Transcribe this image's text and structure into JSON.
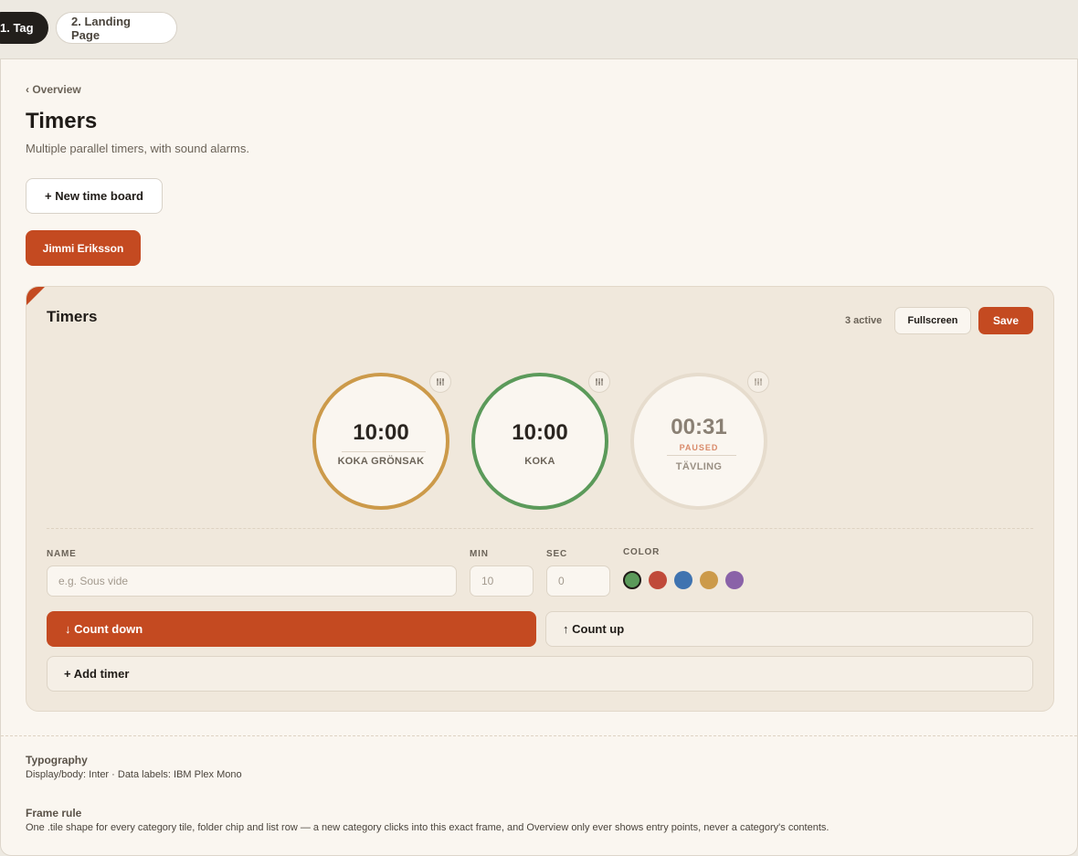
{
  "tabs": [
    {
      "label": "1. Tag",
      "active": true
    },
    {
      "label": "2. Landing Page",
      "active": false
    }
  ],
  "breadcrumb": "‹ Overview",
  "page": {
    "title": "Timers",
    "subtitle": "Multiple parallel timers, with sound alarms."
  },
  "buttons": {
    "new_board": "+ New time board",
    "user": "Jimmi Eriksson"
  },
  "board": {
    "title": "Timers",
    "active_count": "3 active",
    "fullscreen": "Fullscreen",
    "save": "Save",
    "timers": [
      {
        "time": "10:00",
        "name": "KOKA GRÖNSAK",
        "color": "#cc9a4a",
        "status": ""
      },
      {
        "time": "10:00",
        "name": "KOKA",
        "color": "#5b9a5a",
        "status": ""
      },
      {
        "time": "00:31",
        "name": "TÄVLING",
        "color": "#e6dccd",
        "status": "PAUSED"
      }
    ]
  },
  "form": {
    "name_label": "NAME",
    "name_placeholder": "e.g. Sous vide",
    "min_label": "MIN",
    "min_placeholder": "10",
    "sec_label": "SEC",
    "sec_placeholder": "0",
    "color_label": "COLOR",
    "colors": [
      "#5b9a5a",
      "#c04a3a",
      "#3f73b0",
      "#cc9a4a",
      "#8a62a8"
    ],
    "selected_color": "#5b9a5a",
    "count_down": "↓ Count down",
    "count_up": "↑ Count up",
    "add_timer": "+ Add timer"
  },
  "notes": {
    "typography_heading": "Typography",
    "typography_body": "Display/body: Inter · Data labels: IBM Plex Mono",
    "frame_heading": "Frame rule",
    "frame_body": "One .tile shape for every category tile, folder chip and list row — a new category clicks into this exact frame, and Overview only ever shows entry points, never a category's contents."
  }
}
